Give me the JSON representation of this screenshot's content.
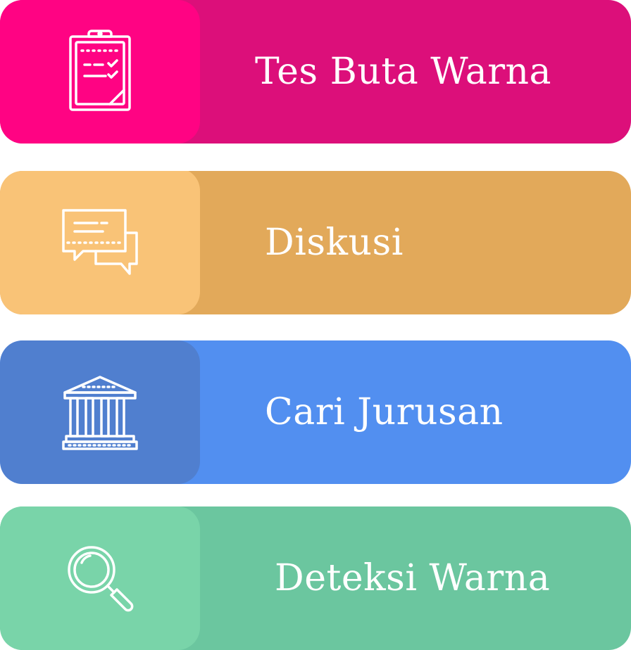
{
  "menu": {
    "items": [
      {
        "label": "Tes Buta Warna",
        "icon": "clipboard-checklist-icon"
      },
      {
        "label": "Diskusi",
        "icon": "chat-bubbles-icon"
      },
      {
        "label": "Cari Jurusan",
        "icon": "university-building-icon"
      },
      {
        "label": "Deteksi Warna",
        "icon": "magnifier-icon"
      }
    ]
  },
  "colors": {
    "tes_buta_warna": {
      "panel": "#ff0383",
      "card": "#dc0f7a"
    },
    "diskusi": {
      "panel": "#f9c377",
      "card": "#e2a95a"
    },
    "cari_jurusan": {
      "panel": "#507fcf",
      "card": "#528ff0"
    },
    "deteksi_warna": {
      "panel": "#79d4a9",
      "card": "#6bc69f"
    },
    "text": "#ffffff"
  }
}
